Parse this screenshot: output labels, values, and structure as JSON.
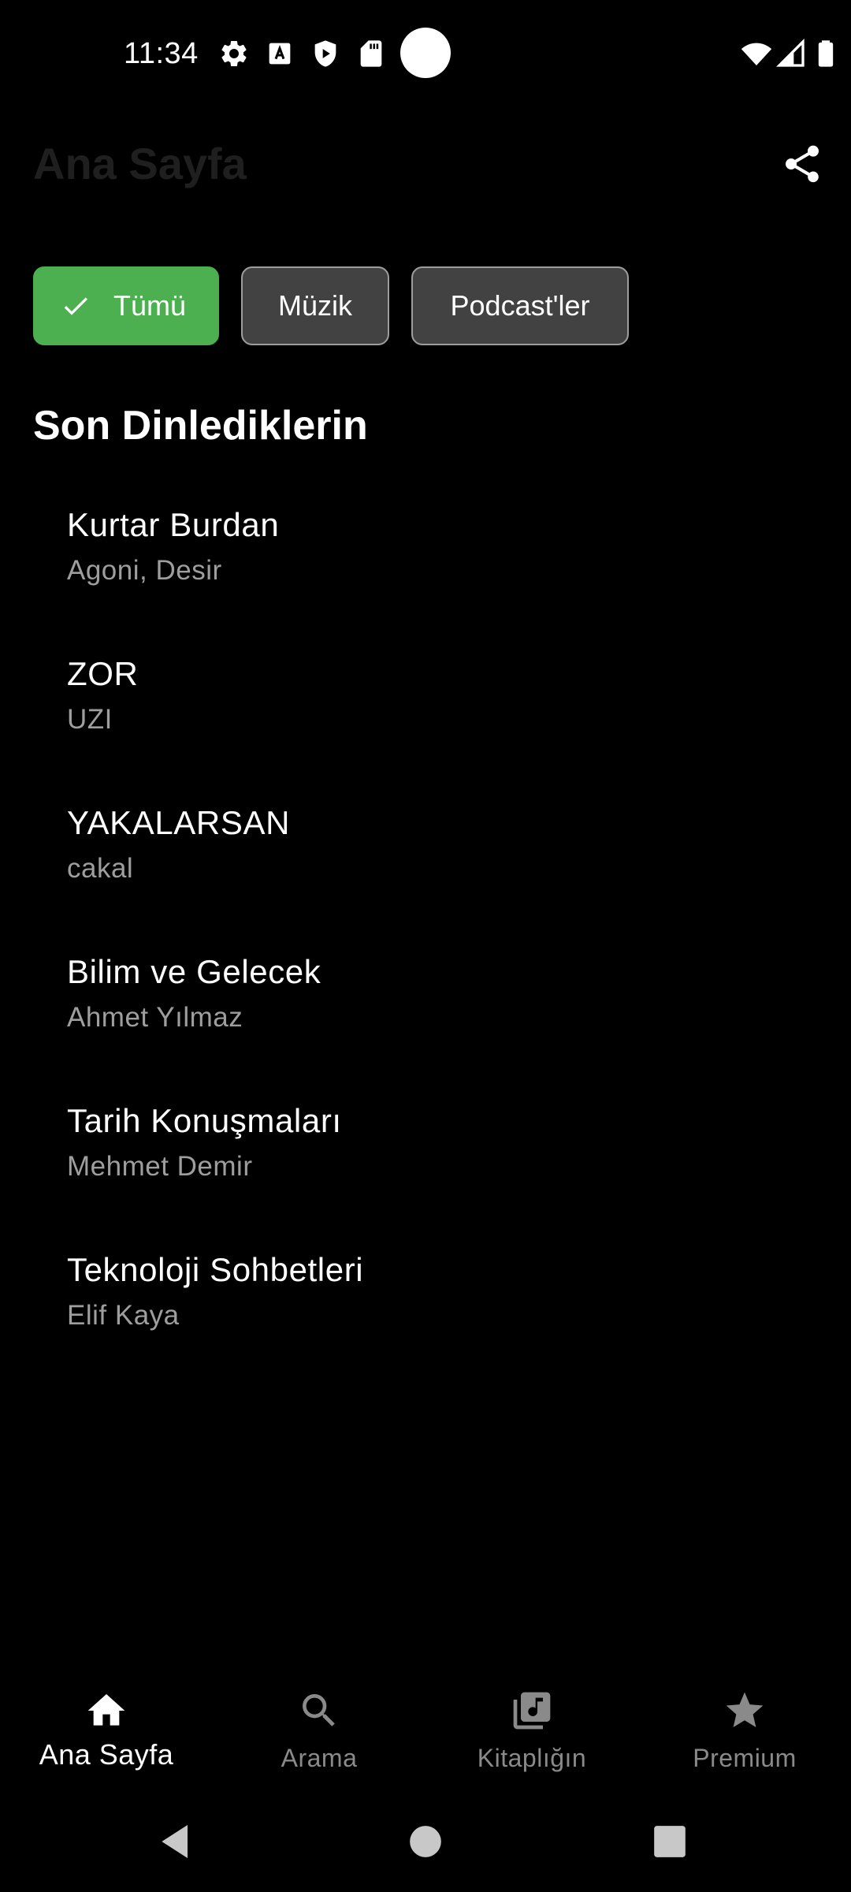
{
  "status_bar": {
    "time": "11:34",
    "icons": [
      "gear-icon",
      "a-box-icon",
      "shield-play-icon",
      "sd-card-icon",
      "wifi-icon",
      "signal-icon",
      "battery-icon"
    ]
  },
  "header": {
    "title": "Ana Sayfa",
    "share_icon": "share-icon"
  },
  "filters": {
    "all": "Tümü",
    "music": "Müzik",
    "podcasts": "Podcast'ler",
    "selected": "all"
  },
  "recent": {
    "section_title": "Son Dinlediklerin",
    "items": [
      {
        "title": "Kurtar Burdan",
        "subtitle": "Agoni, Desir"
      },
      {
        "title": "ZOR",
        "subtitle": "UZI"
      },
      {
        "title": "YAKALARSAN",
        "subtitle": "cakal"
      },
      {
        "title": "Bilim ve Gelecek",
        "subtitle": "Ahmet Yılmaz"
      },
      {
        "title": "Tarih Konuşmaları",
        "subtitle": "Mehmet Demir"
      },
      {
        "title": "Teknoloji Sohbetleri",
        "subtitle": "Elif Kaya"
      }
    ]
  },
  "bottom_nav": {
    "items": [
      {
        "label": "Ana Sayfa",
        "icon": "home-icon",
        "active": true
      },
      {
        "label": "Arama",
        "icon": "search-icon",
        "active": false
      },
      {
        "label": "Kitaplığın",
        "icon": "library-music-icon",
        "active": false
      },
      {
        "label": "Premium",
        "icon": "star-icon",
        "active": false
      }
    ]
  },
  "colors": {
    "background": "#000000",
    "accent": "#4caf50",
    "chip_inactive": "#424242",
    "secondary_text": "#9e9e9e"
  }
}
